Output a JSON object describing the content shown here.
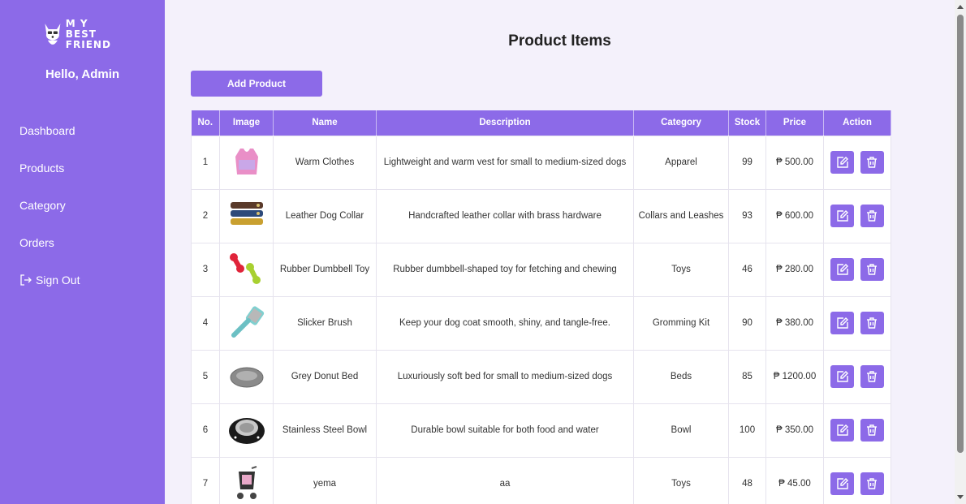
{
  "brand": {
    "logo_line1": "M Y BEST",
    "logo_line2": "FRIEND"
  },
  "sidebar": {
    "greeting": "Hello, Admin",
    "items": [
      {
        "label": "Dashboard"
      },
      {
        "label": "Products"
      },
      {
        "label": "Category"
      },
      {
        "label": "Orders"
      },
      {
        "label": "Sign Out",
        "icon": "sign-out-icon"
      }
    ]
  },
  "main": {
    "title": "Product Items",
    "add_button": "Add Product",
    "columns": [
      "No.",
      "Image",
      "Name",
      "Description",
      "Category",
      "Stock",
      "Price",
      "Action"
    ],
    "rows": [
      {
        "no": "1",
        "image": "vest-image",
        "name": "Warm Clothes",
        "description": "Lightweight and warm vest for small to medium-sized dogs",
        "category": "Apparel",
        "stock": "99",
        "price": "₱ 500.00"
      },
      {
        "no": "2",
        "image": "collar-image",
        "name": "Leather Dog Collar",
        "description": "Handcrafted leather collar with brass hardware",
        "category": "Collars and Leashes",
        "stock": "93",
        "price": "₱ 600.00"
      },
      {
        "no": "3",
        "image": "dumbbell-image",
        "name": "Rubber Dumbbell Toy",
        "description": "Rubber dumbbell-shaped toy for fetching and chewing",
        "category": "Toys",
        "stock": "46",
        "price": "₱ 280.00"
      },
      {
        "no": "4",
        "image": "brush-image",
        "name": "Slicker Brush",
        "description": "Keep your dog coat smooth, shiny, and tangle-free.",
        "category": "Gromming Kit",
        "stock": "90",
        "price": "₱ 380.00"
      },
      {
        "no": "5",
        "image": "bed-image",
        "name": "Grey Donut Bed",
        "description": "Luxuriously soft bed for small to medium-sized dogs",
        "category": "Beds",
        "stock": "85",
        "price": "₱ 1200.00"
      },
      {
        "no": "6",
        "image": "bowl-image",
        "name": "Stainless Steel Bowl",
        "description": "Durable bowl suitable for both food and water",
        "category": "Bowl",
        "stock": "100",
        "price": "₱ 350.00"
      },
      {
        "no": "7",
        "image": "stroller-image",
        "name": "yema",
        "description": "aa",
        "category": "Toys",
        "stock": "48",
        "price": "₱ 45.00"
      }
    ]
  },
  "colors": {
    "accent": "#8c6ae8",
    "background": "#f4f1fb"
  }
}
